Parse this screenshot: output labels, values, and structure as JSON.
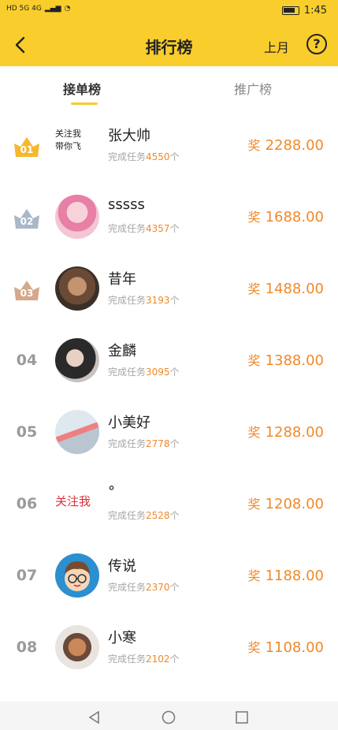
{
  "status": {
    "left_text": "HD 5G 4G",
    "time": "1:45"
  },
  "header": {
    "title": "排行榜",
    "month_label": "上月",
    "help_label": "?"
  },
  "tabs": [
    {
      "label": "接单榜",
      "active": true
    },
    {
      "label": "推广榜",
      "active": false
    }
  ],
  "stats_prefix": "完成任务",
  "stats_suffix": "个",
  "reward_label": "奖",
  "rows": [
    {
      "rank": "01",
      "name": "张大帅",
      "count": "4550",
      "reward": "2288.00",
      "avatar_text_1": "关注我",
      "avatar_text_2": "带你飞"
    },
    {
      "rank": "02",
      "name": "sssss",
      "count": "4357",
      "reward": "1688.00"
    },
    {
      "rank": "03",
      "name": "昔年",
      "count": "3193",
      "reward": "1488.00"
    },
    {
      "rank": "04",
      "name": "金麟",
      "count": "3095",
      "reward": "1388.00"
    },
    {
      "rank": "05",
      "name": "小美好",
      "count": "2778",
      "reward": "1288.00"
    },
    {
      "rank": "06",
      "name": "°",
      "count": "2528",
      "reward": "1208.00",
      "avatar_follow": "关注我"
    },
    {
      "rank": "07",
      "name": "传说",
      "count": "2370",
      "reward": "1188.00"
    },
    {
      "rank": "08",
      "name": "小寒",
      "count": "2102",
      "reward": "1108.00"
    }
  ],
  "colors": {
    "accent": "#f8cd2c",
    "reward": "#f0892b",
    "gold": "#f5b82e",
    "silver": "#a9b8c8",
    "bronze": "#d4a88a"
  }
}
